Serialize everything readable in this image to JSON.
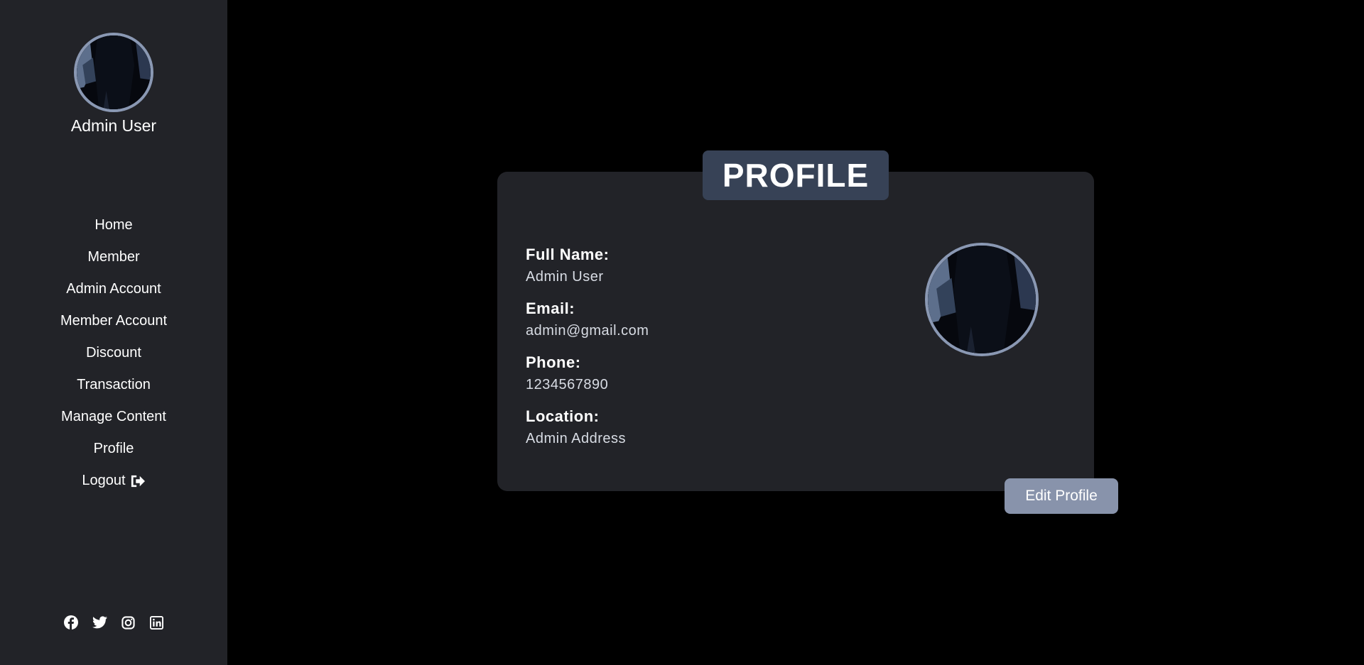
{
  "sidebar": {
    "user_name": "Admin User",
    "nav": [
      {
        "label": "Home"
      },
      {
        "label": "Member"
      },
      {
        "label": "Admin Account"
      },
      {
        "label": "Member Account"
      },
      {
        "label": "Discount"
      },
      {
        "label": "Transaction"
      },
      {
        "label": "Manage Content"
      },
      {
        "label": "Profile"
      },
      {
        "label": "Logout",
        "icon": "sign-out-icon"
      }
    ],
    "socials": [
      "facebook-icon",
      "twitter-icon",
      "instagram-icon",
      "linkedin-icon"
    ]
  },
  "profile": {
    "title": "PROFILE",
    "fields": [
      {
        "label": "Full Name:",
        "value": "Admin User"
      },
      {
        "label": "Email:",
        "value": "admin@gmail.com"
      },
      {
        "label": "Phone:",
        "value": "1234567890"
      },
      {
        "label": "Location:",
        "value": "Admin Address"
      }
    ],
    "edit_label": "Edit Profile"
  },
  "colors": {
    "page_bg": "#000000",
    "sidebar_bg": "#222328",
    "card_bg": "#222328",
    "title_badge_bg": "#374256",
    "accent": "#8893ab",
    "avatar_border": "#8a98b3"
  }
}
